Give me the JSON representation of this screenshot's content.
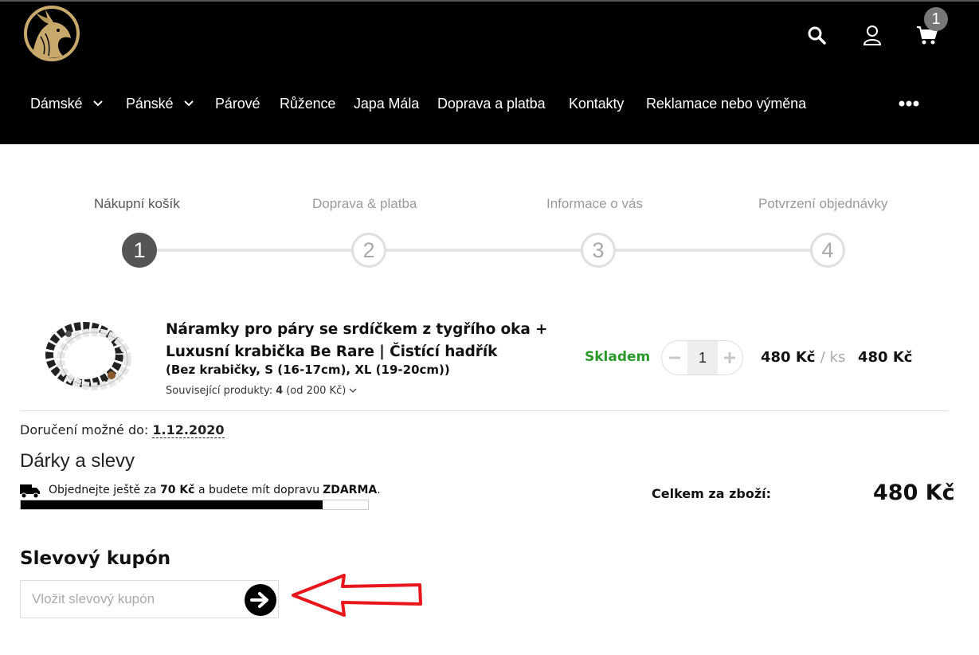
{
  "header": {
    "cart_count": "1",
    "nav": [
      {
        "label": "Dámské",
        "dropdown": true
      },
      {
        "label": "Pánské",
        "dropdown": true
      },
      {
        "label": "Párové"
      },
      {
        "label": "Růžence"
      },
      {
        "label": "Japa Mála"
      },
      {
        "label": "Doprava a platba"
      },
      {
        "label": "Kontakty"
      },
      {
        "label": "Reklamace nebo výměna"
      }
    ],
    "icons": [
      "unicorn-logo",
      "search-icon",
      "user-icon",
      "cart-icon",
      "more-icon"
    ]
  },
  "steps": [
    {
      "num": "1",
      "label": "Nákupní košík",
      "active": true
    },
    {
      "num": "2",
      "label": "Doprava & platba",
      "active": false
    },
    {
      "num": "3",
      "label": "Informace o vás",
      "active": false
    },
    {
      "num": "4",
      "label": "Potvrzení objednávky",
      "active": false
    }
  ],
  "cart": {
    "item": {
      "name_line1": "Náramky pro páry se srdíčkem z tygřího oka +",
      "name_line2": "Luxusní krabička Be Rare | Čistící hadřík",
      "variant": "(Bez krabičky, S (16-17cm), XL (19-20cm))",
      "related_prefix": "Související produkty:",
      "related_count": "4",
      "related_suffix": "(od 200 Kč)",
      "stock": "Skladem",
      "quantity": "1",
      "unit_price": "480 Kč",
      "unit_suffix": "/ ks",
      "total": "480 Kč",
      "stock_color": "#2a9a2a"
    }
  },
  "delivery": {
    "label": "Doručení možné do:",
    "date": "1.12.2020"
  },
  "gifts": {
    "title": "Dárky a slevy",
    "text_before": "Objednejte ještě za",
    "amount": "70 Kč",
    "text_middle": "a budete mít dopravu",
    "free": "ZDARMA",
    "text_end": ".",
    "progress_percent": 87
  },
  "summary": {
    "label": "Celkem za zboží:",
    "value": "480 Kč"
  },
  "coupon": {
    "title": "Slevový kupón",
    "placeholder": "Vložit slevový kupón"
  }
}
